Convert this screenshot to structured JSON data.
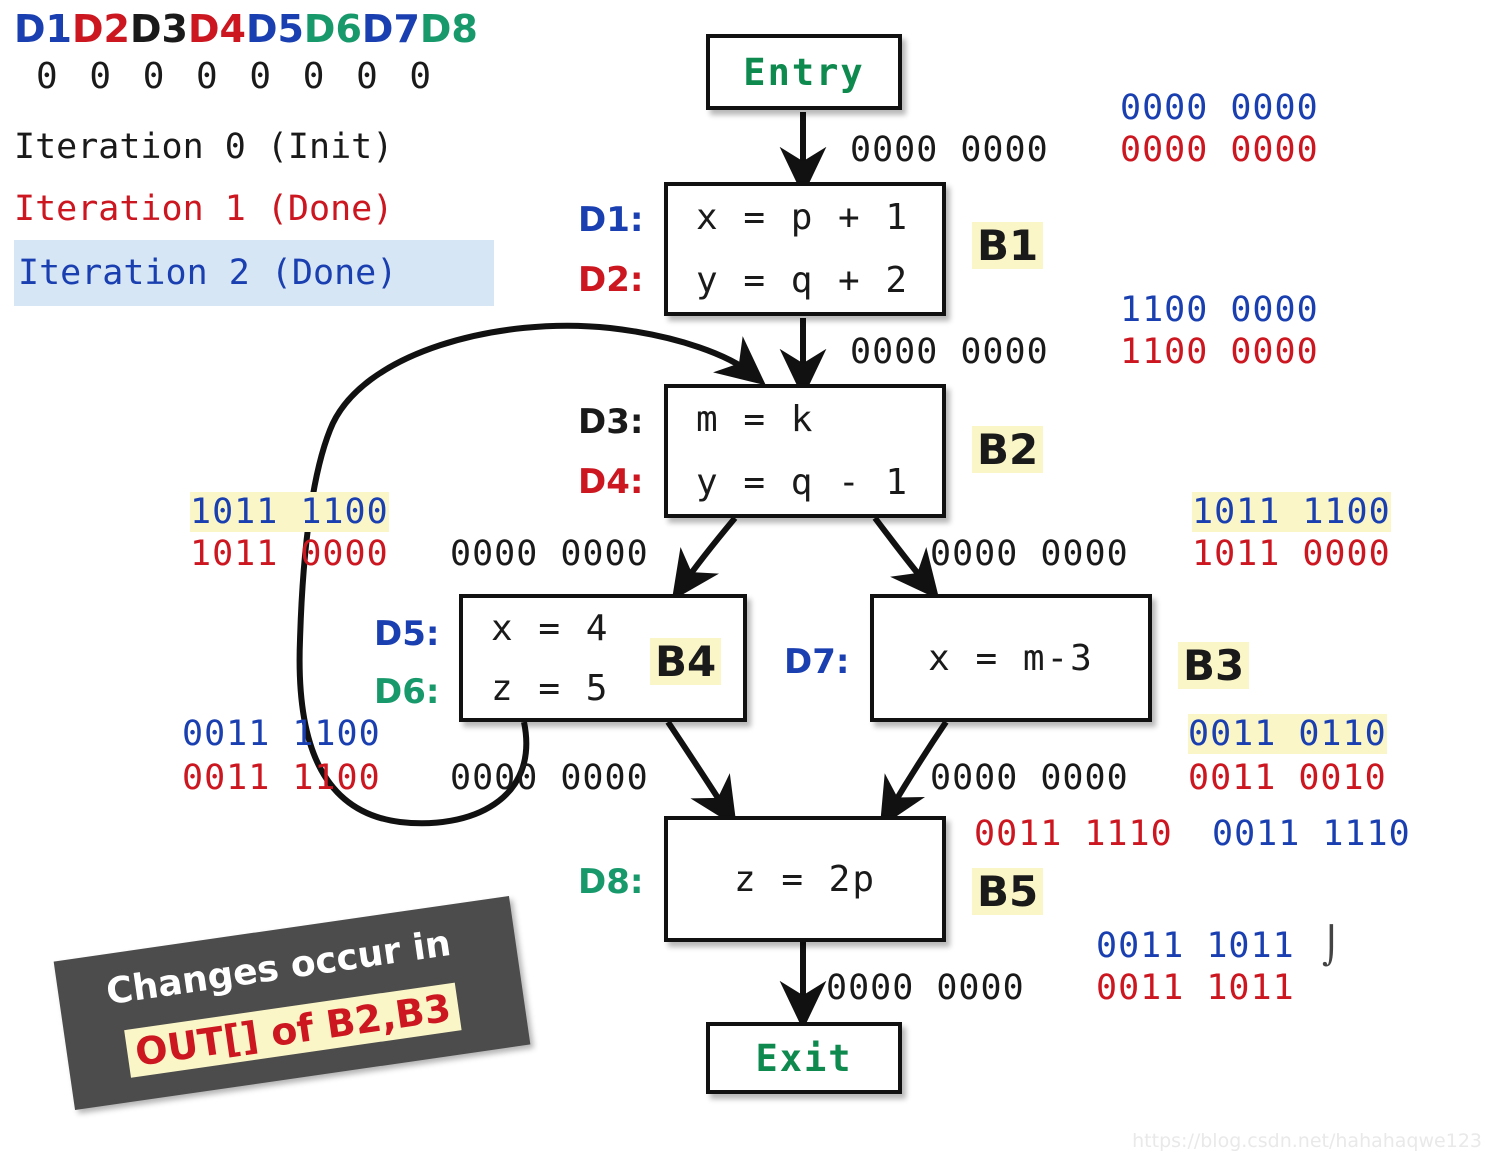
{
  "legend": {
    "def_ids": [
      {
        "label": "D1",
        "color": "#1a3fb0"
      },
      {
        "label": "D2",
        "color": "#cc1620"
      },
      {
        "label": "D3",
        "color": "#1a1a1a"
      },
      {
        "label": "D4",
        "color": "#cc1620"
      },
      {
        "label": "D5",
        "color": "#1a3fb0"
      },
      {
        "label": "D6",
        "color": "#17996b"
      },
      {
        "label": "D7",
        "color": "#1a3fb0"
      },
      {
        "label": "D8",
        "color": "#17996b"
      }
    ],
    "bit_positions": "0 0 0 0 0 0 0 0",
    "iterations": [
      {
        "label": "Iteration 0 (Init)",
        "color": "#1a1a1a",
        "highlighted": false
      },
      {
        "label": "Iteration 1 (Done)",
        "color": "#cc1620",
        "highlighted": false
      },
      {
        "label": "Iteration 2 (Done)",
        "color": "#1a3fb0",
        "highlighted": true
      }
    ]
  },
  "graph": {
    "entry": {
      "label": "Entry"
    },
    "exit": {
      "label": "Exit"
    },
    "blocks": [
      {
        "name": "B1",
        "defs": [
          {
            "id": "D1",
            "color": "#1a3fb0",
            "stmt": "x = p + 1"
          },
          {
            "id": "D2",
            "color": "#cc1620",
            "stmt": "y = q + 2"
          }
        ]
      },
      {
        "name": "B2",
        "defs": [
          {
            "id": "D3",
            "color": "#1a1a1a",
            "stmt": "m = k"
          },
          {
            "id": "D4",
            "color": "#cc1620",
            "stmt": "y = q - 1"
          }
        ]
      },
      {
        "name": "B4",
        "defs": [
          {
            "id": "D5",
            "color": "#1a3fb0",
            "stmt": "x = 4"
          },
          {
            "id": "D6",
            "color": "#17996b",
            "stmt": "z = 5"
          }
        ]
      },
      {
        "name": "B3",
        "defs": [
          {
            "id": "D7",
            "color": "#1a3fb0",
            "stmt": "x = m-3"
          }
        ]
      },
      {
        "name": "B5",
        "defs": [
          {
            "id": "D8",
            "color": "#17996b",
            "stmt": "z = 2p"
          }
        ]
      }
    ]
  },
  "bitvectors": {
    "entry_out_black": "0000 0000",
    "b1_in_blue": "0000 0000",
    "b1_in_red": "0000 0000",
    "b1_out_black": "0000 0000",
    "b1_out_blue": "1100 0000",
    "b1_out_red": "1100 0000",
    "b2_in_left_blue": "1011 1100",
    "b2_in_left_red": "1011 0000",
    "b2_in_left_black": "0000 0000",
    "b2_out_right_blue": "1011 1100",
    "b2_out_right_red": "1011 0000",
    "b2_out_right_black": "0000 0000",
    "b4_out_blue": "0011 1100",
    "b4_out_red": "0011 1100",
    "b4_out_black": "0000 0000",
    "b3_out_black": "0000 0000",
    "b3_out_blue": "0011 0110",
    "b3_out_red": "0011 0010",
    "b5_in_red": "0011 1110",
    "b5_in_blue": "0011 1110",
    "b5_out_black": "0000 0000",
    "b5_out_blue": "0011 1011",
    "b5_out_red": "0011 1011"
  },
  "sticker": {
    "line1": "Changes occur in",
    "line2": "OUT[] of B2,B3"
  },
  "watermark": "https://blog.csdn.net/hahahaqwe123",
  "colors": {
    "blue": "#1a3fb0",
    "red": "#cc1620",
    "green": "#17996b",
    "black": "#1a1a1a",
    "highlight": "#fbf6c8",
    "selection": "#d6e6f5"
  }
}
